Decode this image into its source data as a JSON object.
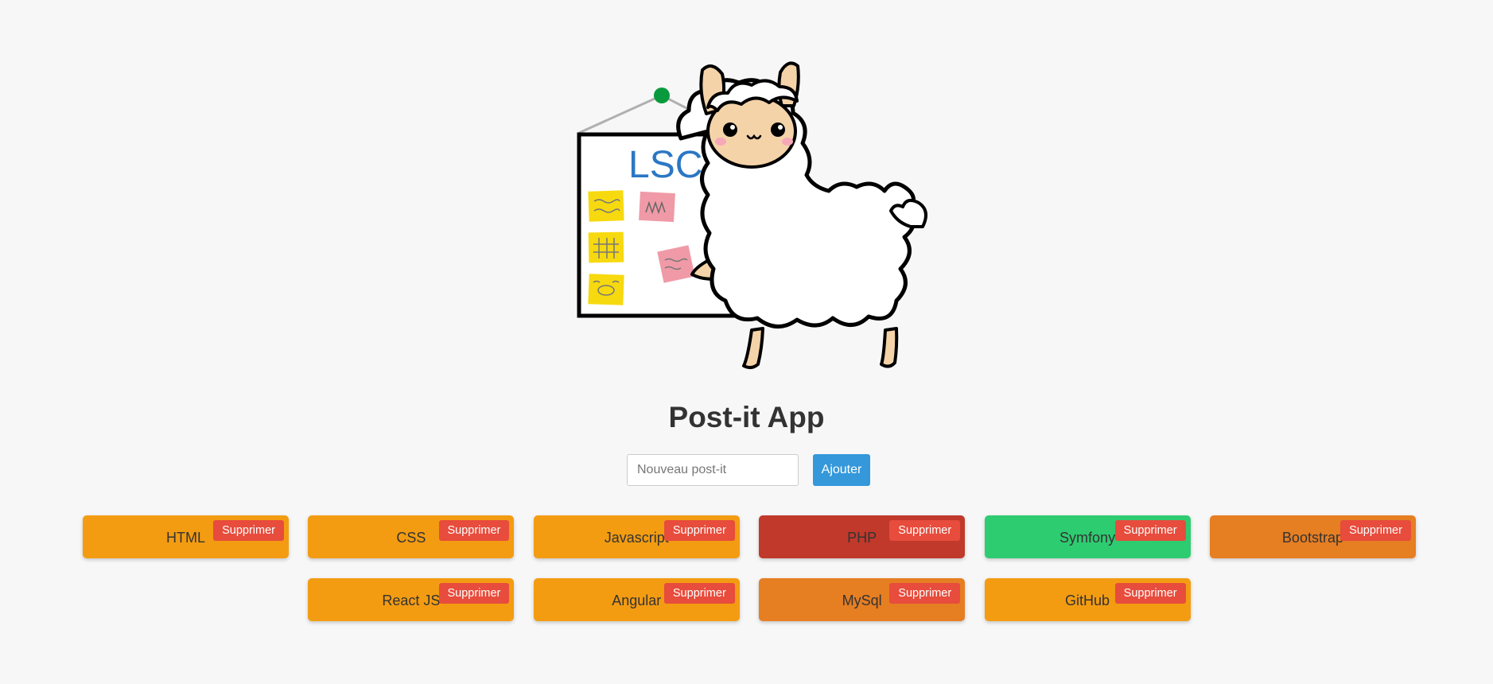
{
  "app": {
    "title": "Post-it App",
    "illustration": "llama-whiteboard-illustration",
    "whiteboard_text": "LSC"
  },
  "form": {
    "placeholder": "Nouveau post-it",
    "value": "",
    "add_label": "Ajouter"
  },
  "postits": [
    {
      "label": "HTML",
      "color": "#f39c12",
      "delete_label": "Supprimer"
    },
    {
      "label": "CSS",
      "color": "#f39c12",
      "delete_label": "Supprimer"
    },
    {
      "label": "Javascript",
      "color": "#f39c12",
      "delete_label": "Supprimer"
    },
    {
      "label": "PHP",
      "color": "#c0392b",
      "delete_label": "Supprimer"
    },
    {
      "label": "Symfony",
      "color": "#2ecc71",
      "delete_label": "Supprimer"
    },
    {
      "label": "Bootstrap",
      "color": "#e67e22",
      "delete_label": "Supprimer"
    },
    {
      "label": "React JS",
      "color": "#f39c12",
      "delete_label": "Supprimer"
    },
    {
      "label": "Angular",
      "color": "#f39c12",
      "delete_label": "Supprimer"
    },
    {
      "label": "MySql",
      "color": "#e67e22",
      "delete_label": "Supprimer"
    },
    {
      "label": "GitHub",
      "color": "#f39c12",
      "delete_label": "Supprimer"
    }
  ],
  "colors": {
    "background": "#f7f7f7",
    "add_button": "#3498db",
    "delete_button": "#e74c3c"
  }
}
